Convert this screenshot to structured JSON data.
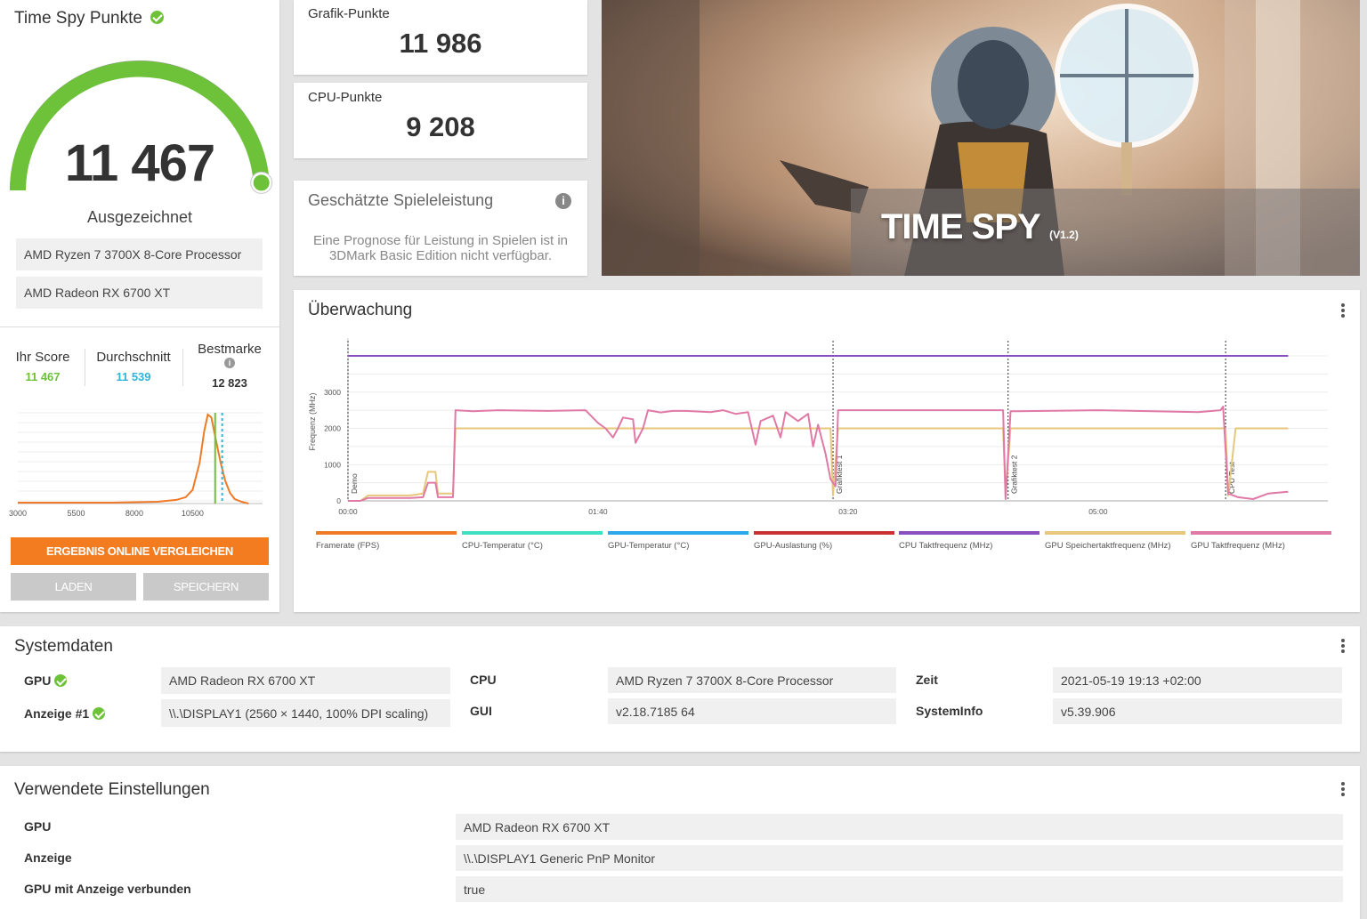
{
  "score_panel": {
    "title": "Time Spy Punkte",
    "score": "11 467",
    "rating": "Ausgezeichnet",
    "cpu": "AMD Ryzen 7 3700X 8-Core Processor",
    "gpu": "AMD Radeon RX 6700 XT",
    "gauge_fraction": 0.98,
    "your_score_label": "Ihr Score",
    "your_score": "11 467",
    "average_label": "Durchschnitt",
    "average": "11 539",
    "best_label": "Bestmarke",
    "best": "12 823",
    "compare_button": "ERGEBNIS ONLINE VERGLEICHEN",
    "load_button": "LADEN",
    "save_button": "SPEICHERN"
  },
  "distribution_chart": {
    "type": "line",
    "x_ticks": [
      "3000",
      "5500",
      "8000",
      "10500"
    ],
    "xlim": [
      3000,
      13500
    ],
    "series": [
      {
        "x": [
          3000,
          4000,
          5000,
          6000,
          7000,
          8000,
          9000,
          9800,
          10200,
          10500,
          10800,
          11000,
          11150,
          11300,
          11500,
          11700,
          11900,
          12100,
          12300,
          12600,
          12900
        ],
        "y": [
          0.01,
          0.01,
          0.01,
          0.01,
          0.01,
          0.015,
          0.02,
          0.04,
          0.07,
          0.15,
          0.45,
          0.8,
          0.98,
          0.95,
          0.7,
          0.45,
          0.25,
          0.12,
          0.05,
          0.02,
          0.0
        ]
      }
    ],
    "your_score_value": 11467,
    "average_value": 11539,
    "colors": {
      "curve": "#ee7a27",
      "your_score": "#6dc23a",
      "average": "#2eb5d9"
    }
  },
  "scores": {
    "graphics_label": "Grafik-Punkte",
    "graphics": "11 986",
    "cpu_label": "CPU-Punkte",
    "cpu": "9 208",
    "estimate_title": "Geschätzte Spieleleistung",
    "estimate_text": "Eine Prognose für Leistung in Spielen ist in 3DMark Basic Edition nicht verfügbar."
  },
  "hero": {
    "title": "TIME SPY",
    "version": "(V1.2)"
  },
  "monitoring": {
    "title": "Überwachung",
    "chart_data": {
      "type": "line",
      "ylabel": "Frequenz (MHz)",
      "y_ticks": [
        "0",
        "1000",
        "2000",
        "3000"
      ],
      "ylim": [
        0,
        4000
      ],
      "x_ticks": [
        "00:00",
        "01:40",
        "03:20",
        "05:00"
      ],
      "xlim": [
        0,
        336
      ],
      "markers": [
        {
          "t": 0,
          "label": "Demo"
        },
        {
          "t": 194,
          "label": "Grafiktest 1"
        },
        {
          "t": 264,
          "label": "Grafiktest 2"
        },
        {
          "t": 351,
          "label": "CPU Test"
        }
      ],
      "series": [
        {
          "name": "CPU Taktfrequenz (MHz)",
          "color": "#8a4fbf",
          "points": [
            [
              0,
              4000
            ],
            [
              376,
              4000
            ]
          ]
        },
        {
          "name": "GPU Speichertaktfrequenz (MHz)",
          "color": "#e6c77b",
          "points": [
            [
              0,
              0
            ],
            [
              5,
              0
            ],
            [
              8,
              150
            ],
            [
              25,
              150
            ],
            [
              30,
              200
            ],
            [
              32,
              800
            ],
            [
              35,
              800
            ],
            [
              36,
              200
            ],
            [
              42,
              200
            ],
            [
              43,
              2000
            ],
            [
              193,
              2000
            ],
            [
              194,
              150
            ],
            [
              196,
              2000
            ],
            [
              262,
              2000
            ],
            [
              263,
              100
            ],
            [
              265,
              2000
            ],
            [
              351,
              2000
            ],
            [
              352,
              150
            ],
            [
              355,
              2000
            ],
            [
              376,
              2000
            ]
          ]
        },
        {
          "name": "GPU Taktfrequenz (MHz)",
          "color": "#e079a6",
          "points": [
            [
              0,
              0
            ],
            [
              5,
              0
            ],
            [
              8,
              80
            ],
            [
              25,
              80
            ],
            [
              30,
              100
            ],
            [
              32,
              500
            ],
            [
              35,
              500
            ],
            [
              36,
              100
            ],
            [
              42,
              100
            ],
            [
              43,
              2500
            ],
            [
              50,
              2470
            ],
            [
              60,
              2500
            ],
            [
              80,
              2480
            ],
            [
              95,
              2500
            ],
            [
              100,
              2150
            ],
            [
              103,
              2000
            ],
            [
              106,
              1750
            ],
            [
              108,
              2000
            ],
            [
              110,
              2300
            ],
            [
              114,
              2250
            ],
            [
              115,
              1600
            ],
            [
              118,
              2000
            ],
            [
              120,
              2500
            ],
            [
              125,
              2440
            ],
            [
              130,
              2480
            ],
            [
              135,
              2480
            ],
            [
              145,
              2450
            ],
            [
              150,
              2500
            ],
            [
              155,
              2400
            ],
            [
              160,
              2450
            ],
            [
              163,
              1550
            ],
            [
              165,
              2200
            ],
            [
              170,
              2350
            ],
            [
              173,
              1750
            ],
            [
              175,
              2450
            ],
            [
              180,
              2200
            ],
            [
              184,
              2400
            ],
            [
              186,
              1500
            ],
            [
              188,
              2100
            ],
            [
              191,
              1300
            ],
            [
              193,
              600
            ],
            [
              195,
              400
            ],
            [
              196,
              2500
            ],
            [
              262,
              2500
            ],
            [
              263,
              50
            ],
            [
              265,
              2470
            ],
            [
              300,
              2500
            ],
            [
              340,
              2450
            ],
            [
              349,
              2500
            ],
            [
              350,
              2600
            ],
            [
              352,
              200
            ],
            [
              356,
              100
            ],
            [
              362,
              50
            ],
            [
              368,
              200
            ],
            [
              376,
              250
            ]
          ]
        }
      ]
    },
    "legend": [
      {
        "name": "Framerate (FPS)",
        "color": "#ee7a27"
      },
      {
        "name": "CPU-Temperatur (°C)",
        "color": "#3de0c3"
      },
      {
        "name": "GPU-Temperatur (°C)",
        "color": "#2ba8e8"
      },
      {
        "name": "GPU-Auslastung (%)",
        "color": "#c93232"
      },
      {
        "name": "CPU Taktfrequenz (MHz)",
        "color": "#8a4fbf"
      },
      {
        "name": "GPU Speichertaktfrequenz (MHz)",
        "color": "#e6c77b"
      },
      {
        "name": "GPU Taktfrequenz (MHz)",
        "color": "#e079a6"
      }
    ]
  },
  "system": {
    "title": "Systemdaten",
    "gpu_label": "GPU",
    "gpu": "AMD Radeon RX 6700 XT",
    "display_label": "Anzeige #1",
    "display": "\\\\.\\DISPLAY1 (2560 × 1440, 100% DPI scaling)",
    "cpu_label": "CPU",
    "cpu": "AMD Ryzen 7 3700X 8-Core Processor",
    "gui_label": "GUI",
    "gui": "v2.18.7185 64",
    "time_label": "Zeit",
    "time": "2021-05-19 19:13 +02:00",
    "sysinfo_label": "SystemInfo",
    "sysinfo": "v5.39.906"
  },
  "settings": {
    "title": "Verwendete Einstellungen",
    "rows": [
      {
        "label": "GPU",
        "value": "AMD Radeon RX 6700 XT"
      },
      {
        "label": "Anzeige",
        "value": "\\\\.\\DISPLAY1 Generic PnP Monitor"
      },
      {
        "label": "GPU mit Anzeige verbunden",
        "value": "true"
      }
    ]
  }
}
